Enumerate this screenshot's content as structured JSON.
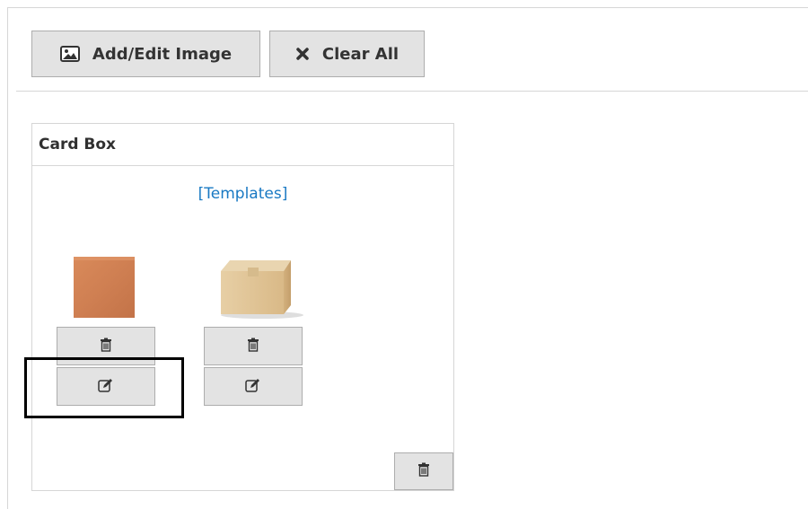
{
  "toolbar": {
    "add_edit_image_label": "Add/Edit Image",
    "clear_all_label": "Clear All"
  },
  "card": {
    "title": "Card Box",
    "templates_link": "[Templates]",
    "images": [
      {
        "icon": "flat-cardboard-box-image"
      },
      {
        "icon": "closed-cardboard-box-image"
      }
    ]
  },
  "icons": {
    "add_image": "image-icon",
    "clear": "x-icon",
    "delete": "trash-icon",
    "edit": "edit-icon"
  },
  "colors": {
    "link": "#1979c3",
    "button_bg": "#e3e3e3",
    "button_border": "#adadad",
    "highlight": "#000000"
  }
}
